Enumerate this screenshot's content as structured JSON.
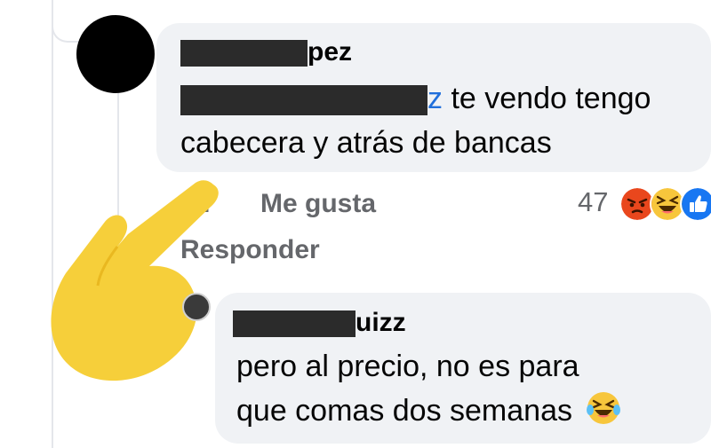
{
  "comment1": {
    "author_visible": "pez",
    "mention_visible": "z",
    "text_line1": "te vendo tengo",
    "text_line2": "cabecera y atrás de bancas",
    "time_visible": "n",
    "like_label": "Me gusta",
    "reply_label": "Responder",
    "reaction_count": "47",
    "reactions": [
      "angry-icon",
      "laugh-icon",
      "like-icon"
    ]
  },
  "comment2": {
    "author_visible": "uizz",
    "text_line1": "pero al precio, no es para",
    "text_line2": "que comas dos semanas",
    "emoji": "laugh-cry-icon"
  },
  "colors": {
    "bubble": "#f0f2f5",
    "mention": "#216fdb",
    "meta_text": "#65676b",
    "hand": "#f6cf3a",
    "redaction": "#2b2b2b"
  }
}
